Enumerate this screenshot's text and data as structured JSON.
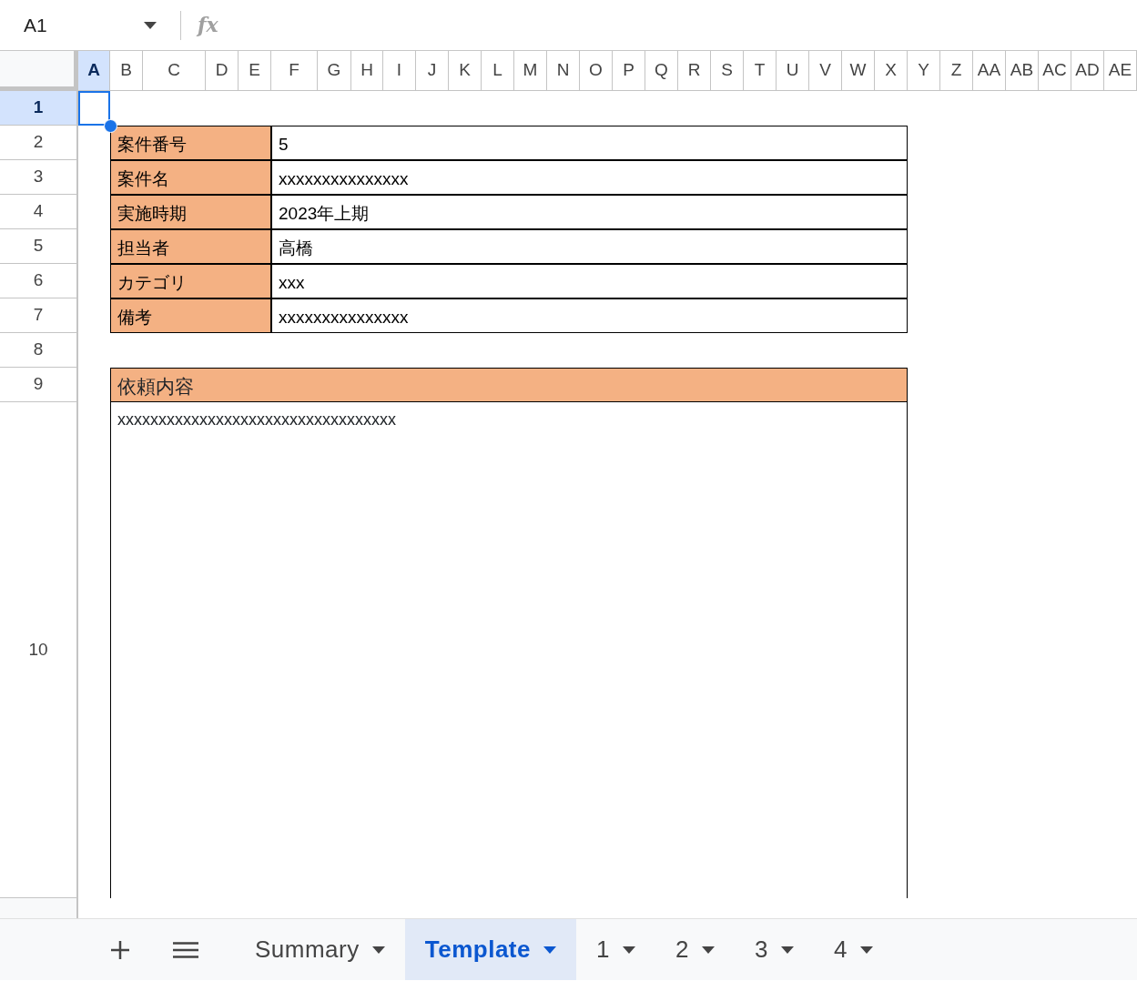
{
  "name_box": "A1",
  "formula_bar": {
    "fx_label": "fx"
  },
  "columns": [
    {
      "label": "A",
      "selected": true
    },
    {
      "label": "B",
      "selected": false
    },
    {
      "label": "C",
      "selected": false
    },
    {
      "label": "D",
      "selected": false
    },
    {
      "label": "E",
      "selected": false
    },
    {
      "label": "F",
      "selected": false
    },
    {
      "label": "G",
      "selected": false
    },
    {
      "label": "H",
      "selected": false
    },
    {
      "label": "I",
      "selected": false
    },
    {
      "label": "J",
      "selected": false
    },
    {
      "label": "K",
      "selected": false
    },
    {
      "label": "L",
      "selected": false
    },
    {
      "label": "M",
      "selected": false
    },
    {
      "label": "N",
      "selected": false
    },
    {
      "label": "O",
      "selected": false
    },
    {
      "label": "P",
      "selected": false
    },
    {
      "label": "Q",
      "selected": false
    },
    {
      "label": "R",
      "selected": false
    },
    {
      "label": "S",
      "selected": false
    },
    {
      "label": "T",
      "selected": false
    },
    {
      "label": "U",
      "selected": false
    },
    {
      "label": "V",
      "selected": false
    },
    {
      "label": "W",
      "selected": false
    },
    {
      "label": "X",
      "selected": false
    },
    {
      "label": "Y",
      "selected": false
    },
    {
      "label": "Z",
      "selected": false
    },
    {
      "label": "AA",
      "selected": false
    },
    {
      "label": "AB",
      "selected": false
    },
    {
      "label": "AC",
      "selected": false
    },
    {
      "label": "AD",
      "selected": false
    },
    {
      "label": "AE",
      "selected": false
    }
  ],
  "rows": [
    {
      "label": "1",
      "selected": true
    },
    {
      "label": "2",
      "selected": false
    },
    {
      "label": "3",
      "selected": false
    },
    {
      "label": "4",
      "selected": false
    },
    {
      "label": "5",
      "selected": false
    },
    {
      "label": "6",
      "selected": false
    },
    {
      "label": "7",
      "selected": false
    },
    {
      "label": "8",
      "selected": false
    },
    {
      "label": "9",
      "selected": false
    },
    {
      "label": "10",
      "selected": false
    }
  ],
  "fields": [
    {
      "label": "案件番号",
      "value": "5"
    },
    {
      "label": "案件名",
      "value": "xxxxxxxxxxxxxxx"
    },
    {
      "label": "実施時期",
      "value": "2023年上期"
    },
    {
      "label": "担当者",
      "value": "高橋"
    },
    {
      "label": "カテゴリ",
      "value": "xxx"
    },
    {
      "label": "備考",
      "value": "xxxxxxxxxxxxxxx"
    }
  ],
  "request": {
    "title": "依頼内容",
    "body": "xxxxxxxxxxxxxxxxxxxxxxxxxxxxxxxxxx"
  },
  "sheet_tabs": [
    {
      "label": "Summary",
      "selected": false
    },
    {
      "label": "Template",
      "selected": true
    },
    {
      "label": "1",
      "selected": false
    },
    {
      "label": "2",
      "selected": false
    },
    {
      "label": "3",
      "selected": false
    },
    {
      "label": "4",
      "selected": false
    }
  ]
}
